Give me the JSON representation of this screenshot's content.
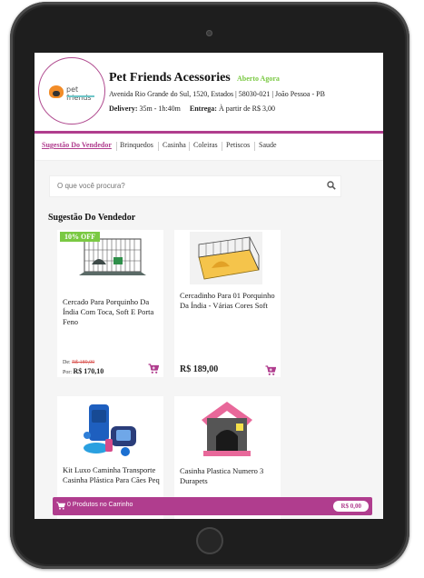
{
  "store": {
    "name": "Pet Friends Acessories",
    "status": "Aberto Agora",
    "address": "Avenida Rio Grande do Sul, 1520, Estados | 58030-021 | João Pessoa - PB",
    "delivery_label": "Delivery:",
    "delivery_time": "35m - 1h:40m",
    "fee_label": "Entrega:",
    "fee_value": "À partir de R$ 3,00",
    "logo_text": "pet friends"
  },
  "tabs": [
    {
      "label": "Sugestão Do Vendedor",
      "active": true
    },
    {
      "label": "Brinquedos"
    },
    {
      "label": "Casinha"
    },
    {
      "label": "Coleiras"
    },
    {
      "label": "Petiscos"
    },
    {
      "label": "Saude"
    }
  ],
  "search": {
    "placeholder": "O que você procura?"
  },
  "section": {
    "title": "Sugestão Do Vendedor"
  },
  "products": [
    {
      "name": "Cercado Para Porquinho Da Índia Com Toca, Soft E Porta Feno",
      "badge": "10% OFF",
      "old_label": "De:",
      "old_price": "R$ 189,00",
      "new_label": "Por:",
      "new_price": "R$ 170,10"
    },
    {
      "name": "Cercadinho Para 01 Porquinho Da Índia - Várias Cores Soft",
      "price": "R$ 189,00"
    },
    {
      "name": "Kit Luxo Caminha Transporte Casinha Plástica Para Cães Peq"
    },
    {
      "name": "Casinha Plastica Numero 3 Durapets"
    }
  ],
  "cart": {
    "label": "0 Produtos no Carrinho",
    "total": "R$ 0,00"
  },
  "colors": {
    "accent": "#b03d8e",
    "status": "#7ac943",
    "discount": "#7ac943"
  }
}
